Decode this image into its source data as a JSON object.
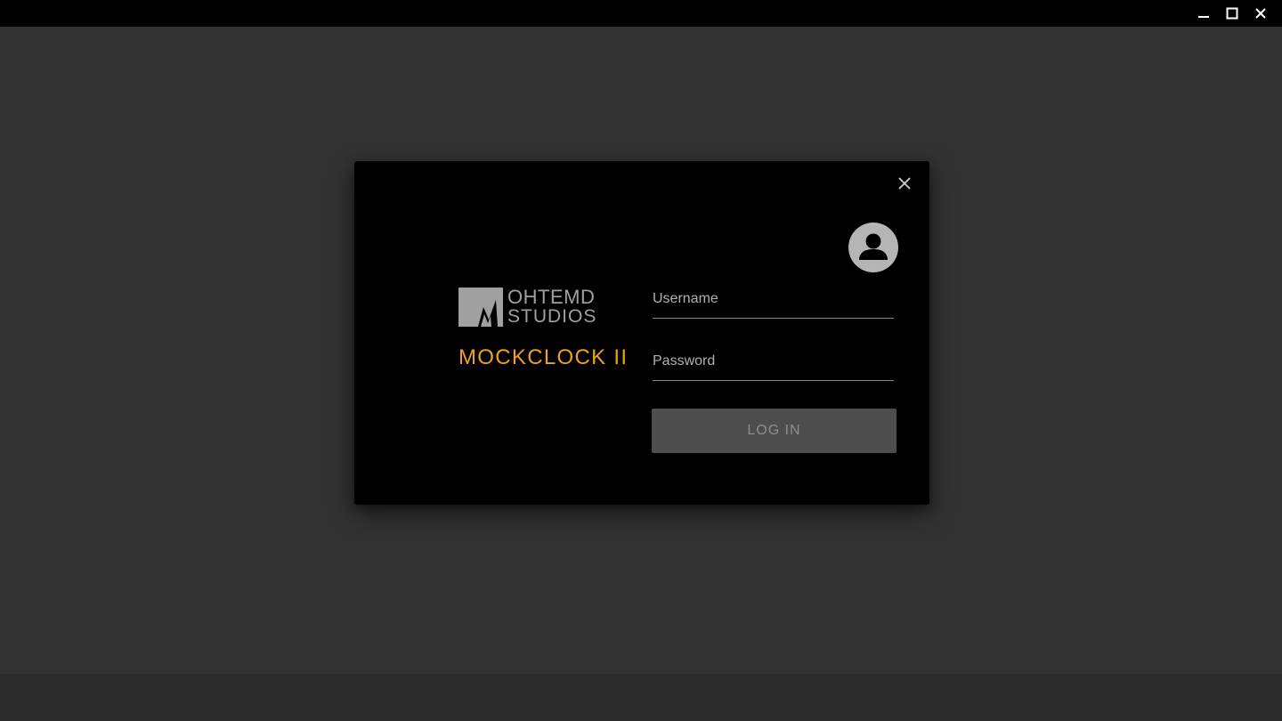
{
  "window_controls": {
    "minimize_icon": "minimize-icon",
    "maximize_icon": "maximize-icon",
    "close_icon": "close-icon"
  },
  "dialog": {
    "close_icon": "close-icon",
    "avatar_icon": "account-circle-icon",
    "logo": {
      "line1": "OHTEMD",
      "line2": "STUDIOS",
      "mark_icon": "studio-logo-mark"
    },
    "product_name": "MOCKCLOCK II",
    "username": {
      "placeholder": "Username",
      "value": ""
    },
    "password": {
      "placeholder": "Password",
      "value": ""
    },
    "login_label": "LOG IN"
  },
  "colors": {
    "background": "#333333",
    "titlebar": "#000000",
    "dialog": "#000000",
    "accent": "#f0a020",
    "logo_gray": "#a0a0a0",
    "button_bg": "#4d4d4d",
    "button_text": "#8e8e8e"
  }
}
